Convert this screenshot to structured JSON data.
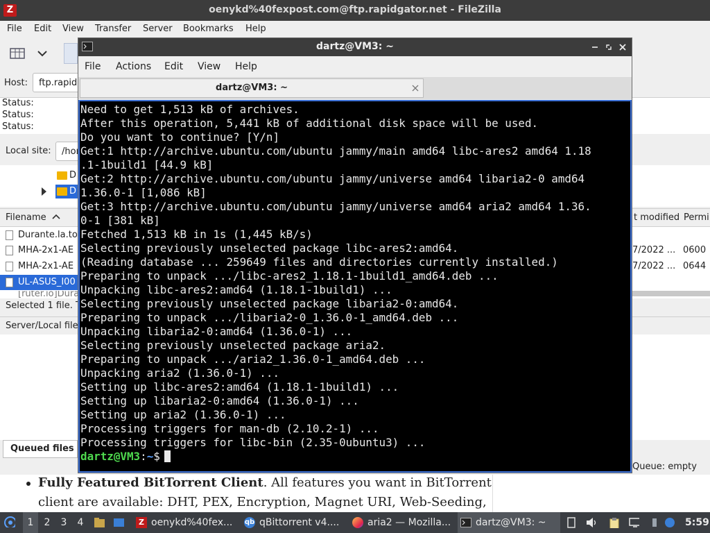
{
  "filezilla": {
    "title": "oenykd%40fexpost.com@ftp.rapidgator.net - FileZilla",
    "menu": [
      "File",
      "Edit",
      "View",
      "Transfer",
      "Server",
      "Bookmarks",
      "Help"
    ],
    "host_label": "Host:",
    "host_value": "ftp.rapid",
    "status_lines": [
      "Status:",
      "Status:",
      "Status:"
    ],
    "local_site_label": "Local site:",
    "local_site_value": "/hor",
    "tree_items": [
      "D",
      "D"
    ],
    "columns": {
      "filename": "Filename",
      "modified": "t modified",
      "perm": "Permi"
    },
    "files": [
      {
        "name": "Durante.la.to",
        "date": "",
        "perm": ""
      },
      {
        "name": "MHA-2x1-AE",
        "date": "7/2022 ...",
        "perm": "0600"
      },
      {
        "name": "MHA-2x1-AE",
        "date": "7/2022 ...",
        "perm": "0644"
      },
      {
        "name": "UL-ASUS_I00",
        "date": "",
        "perm": ""
      },
      {
        "name": "[ruter.io]Dura",
        "date": "",
        "perm": ""
      }
    ],
    "selected_status": "Selected 1 file. T",
    "queue_header": "Server/Local file",
    "queue_tab": "Queued files",
    "queue_empty": "Queue: empty"
  },
  "web": {
    "bullet_bold": "Fully Featured BitTorrent Client",
    "bullet_rest": ". All features you want in BitTorrent",
    "bullet_line2": "client are available: DHT, PEX, Encryption, Magnet URI, Web-Seeding,"
  },
  "terminal": {
    "title": "dartz@VM3: ~",
    "menu": [
      "File",
      "Actions",
      "Edit",
      "View",
      "Help"
    ],
    "tab_title": "dartz@VM3: ~",
    "lines": [
      "Need to get 1,513 kB of archives.",
      "After this operation, 5,441 kB of additional disk space will be used.",
      "Do you want to continue? [Y/n]",
      "Get:1 http://archive.ubuntu.com/ubuntu jammy/main amd64 libc-ares2 amd64 1.18",
      ".1-1build1 [44.9 kB]",
      "Get:2 http://archive.ubuntu.com/ubuntu jammy/universe amd64 libaria2-0 amd64",
      "1.36.0-1 [1,086 kB]",
      "Get:3 http://archive.ubuntu.com/ubuntu jammy/universe amd64 aria2 amd64 1.36.",
      "0-1 [381 kB]",
      "Fetched 1,513 kB in 1s (1,445 kB/s)",
      "Selecting previously unselected package libc-ares2:amd64.",
      "(Reading database ... 259649 files and directories currently installed.)",
      "Preparing to unpack .../libc-ares2_1.18.1-1build1_amd64.deb ...",
      "Unpacking libc-ares2:amd64 (1.18.1-1build1) ...",
      "Selecting previously unselected package libaria2-0:amd64.",
      "Preparing to unpack .../libaria2-0_1.36.0-1_amd64.deb ...",
      "Unpacking libaria2-0:amd64 (1.36.0-1) ...",
      "Selecting previously unselected package aria2.",
      "Preparing to unpack .../aria2_1.36.0-1_amd64.deb ...",
      "Unpacking aria2 (1.36.0-1) ...",
      "Setting up libc-ares2:amd64 (1.18.1-1build1) ...",
      "Setting up libaria2-0:amd64 (1.36.0-1) ...",
      "Setting up aria2 (1.36.0-1) ...",
      "Processing triggers for man-db (2.10.2-1) ...",
      "Processing triggers for libc-bin (2.35-0ubuntu3) ..."
    ],
    "prompt_user": "dartz@VM3",
    "prompt_sep": ":",
    "prompt_path": "~",
    "prompt_symbol": "$"
  },
  "taskbar": {
    "workspaces": [
      "1",
      "2",
      "3",
      "4"
    ],
    "tasks": [
      {
        "label": "oenykd%40fex...",
        "icon": "filezilla-icon"
      },
      {
        "label": "qBittorrent v4....",
        "icon": "qbittorrent-icon"
      },
      {
        "label": "aria2 — Mozilla...",
        "icon": "firefox-icon"
      },
      {
        "label": "dartz@VM3: ~",
        "icon": "terminal-icon"
      }
    ],
    "clock": "5:59",
    "accent": "#3a6fd6"
  }
}
